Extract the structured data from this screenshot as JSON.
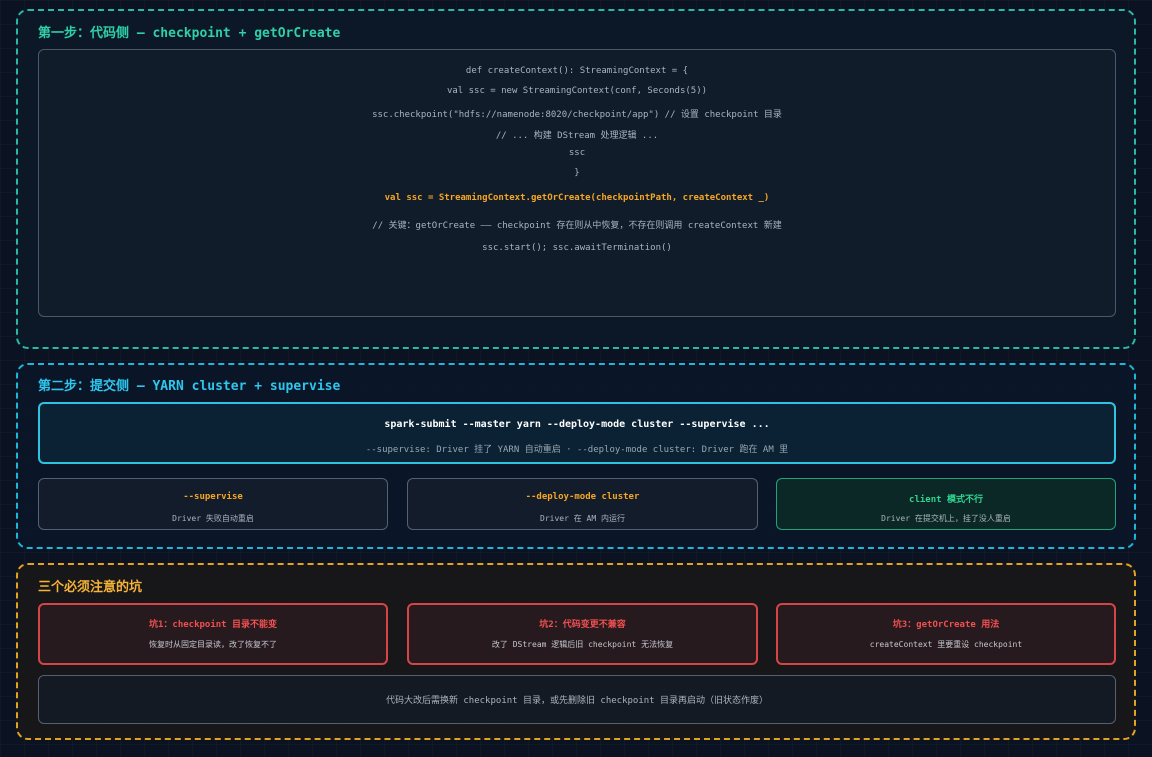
{
  "step1": {
    "title": "第一步：代码侧 — checkpoint + getOrCreate",
    "code_lines": [
      "def createContext(): StreamingContext = {",
      "val ssc = new StreamingContext(conf, Seconds(5))",
      "ssc.checkpoint(\"hdfs://namenode:8020/checkpoint/app\") // 设置 checkpoint 目录",
      "// ... 构建 DStream 处理逻辑 ...",
      "ssc",
      "}",
      "val ssc = StreamingContext.getOrCreate(checkpointPath, createContext _)",
      "// 关键：getOrCreate —— checkpoint 存在则从中恢复，不存在则调用 createContext 新建",
      "ssc.start(); ssc.awaitTermination()"
    ]
  },
  "step2": {
    "title": "第二步：提交侧 — YARN cluster + supervise",
    "command": "spark-submit --master yarn --deploy-mode cluster --supervise ...",
    "command_note": "--supervise: Driver 挂了 YARN 自动重启 · --deploy-mode cluster: Driver 跑在 AM 里",
    "cards": [
      {
        "title": "--supervise",
        "sub": "Driver 失败自动重启"
      },
      {
        "title": "--deploy-mode cluster",
        "sub": "Driver 在 AM 内运行"
      },
      {
        "title": "client 模式不行",
        "sub": "Driver 在提交机上，挂了没人重启"
      }
    ]
  },
  "step3": {
    "title": "三个必须注意的坑",
    "pits": [
      {
        "title": "坑1：checkpoint 目录不能变",
        "sub": "恢复时从固定目录读，改了恢复不了"
      },
      {
        "title": "坑2：代码变更不兼容",
        "sub": "改了 DStream 逻辑后旧 checkpoint 无法恢复"
      },
      {
        "title": "坑3：getOrCreate 用法",
        "sub": "createContext 里要重设 checkpoint"
      }
    ],
    "note": "代码大改后需换新 checkpoint 目录，或先删除旧 checkpoint 目录再启动（旧状态作废）"
  }
}
